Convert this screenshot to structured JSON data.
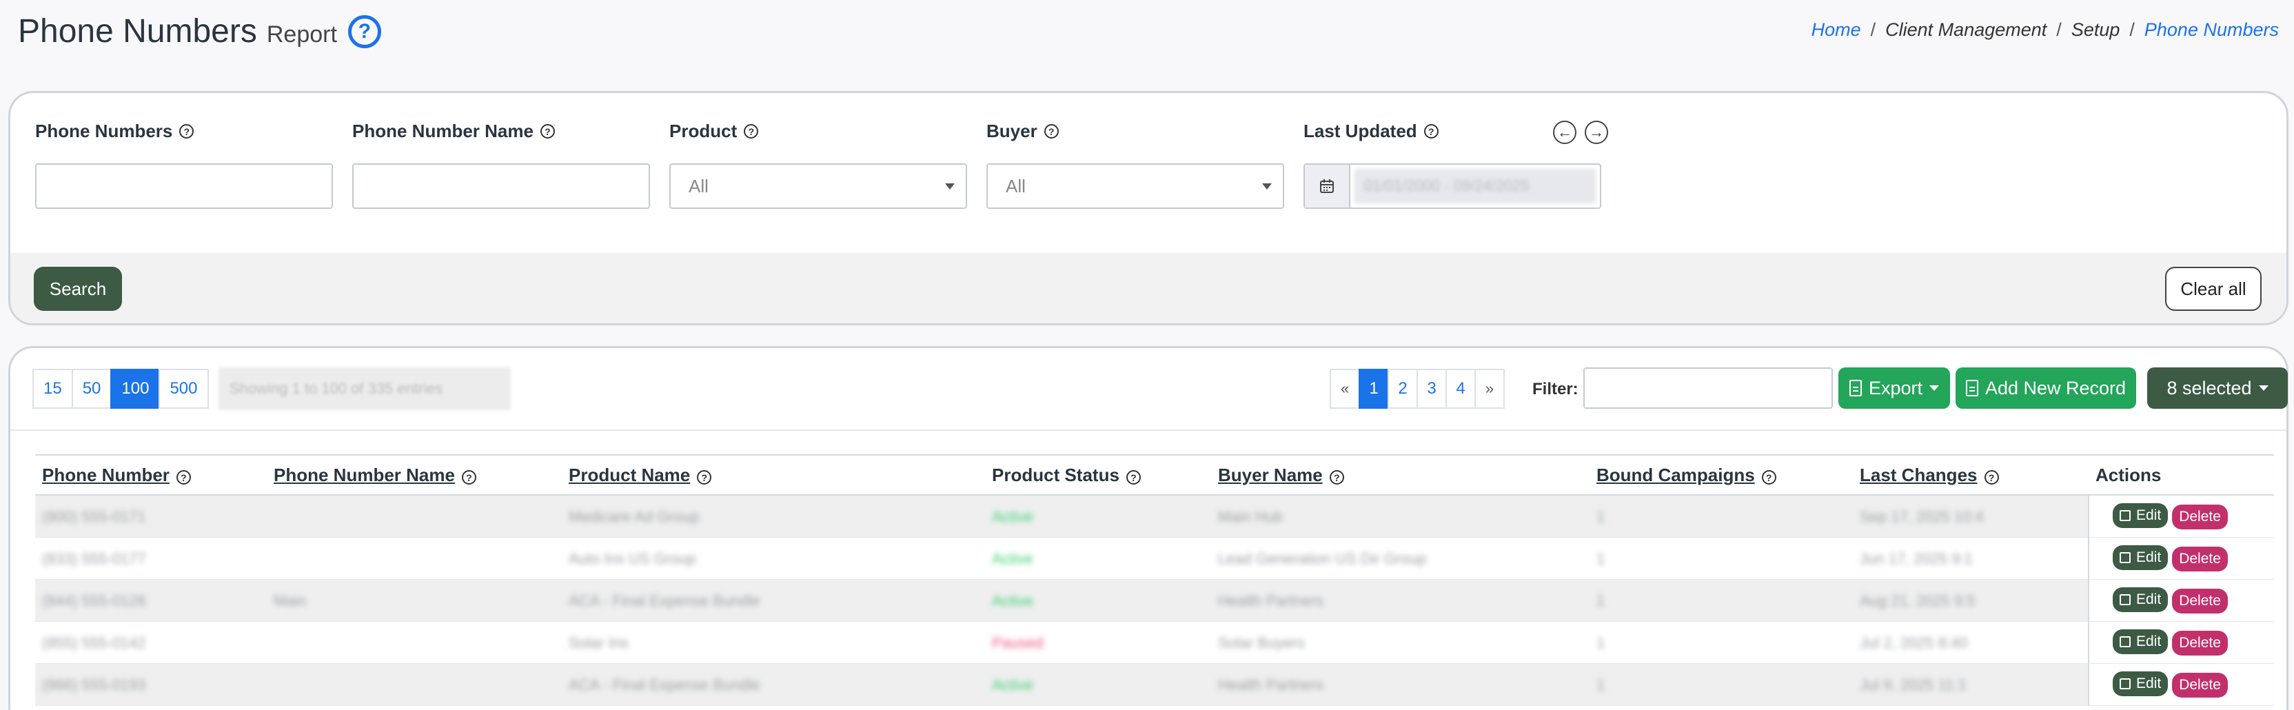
{
  "header": {
    "title": "Phone Numbers",
    "subtitle": "Report",
    "help_icon": "question-circle-icon"
  },
  "breadcrumb": [
    {
      "label": "Home",
      "link": true
    },
    {
      "label": "Client Management",
      "link": false
    },
    {
      "label": "Setup",
      "link": false
    },
    {
      "label": "Phone Numbers",
      "link": true
    }
  ],
  "filters": {
    "phone_numbers": {
      "label": "Phone Numbers",
      "value": ""
    },
    "phone_number_name": {
      "label": "Phone Number Name",
      "value": ""
    },
    "product": {
      "label": "Product",
      "value": "All"
    },
    "buyer": {
      "label": "Buyer",
      "value": "All"
    },
    "last_updated": {
      "label": "Last Updated",
      "value": "01/01/2000 - 09/24/2025"
    },
    "search_label": "Search",
    "clear_label": "Clear all"
  },
  "toolbar": {
    "page_sizes": [
      "15",
      "50",
      "100",
      "500"
    ],
    "active_page_size": "100",
    "entries_info": "Showing 1 to 100 of 335 entries",
    "pages": [
      "«",
      "1",
      "2",
      "3",
      "4",
      "»"
    ],
    "active_page": "1",
    "filter_label": "Filter:",
    "export_label": "Export",
    "add_label": "Add New Record",
    "selected_label": "8 selected"
  },
  "table": {
    "columns": [
      {
        "label": "Phone Number",
        "sortable": true
      },
      {
        "label": "Phone Number Name",
        "sortable": true
      },
      {
        "label": "Product Name",
        "sortable": true
      },
      {
        "label": "Product Status",
        "sortable": false
      },
      {
        "label": "Buyer Name",
        "sortable": true
      },
      {
        "label": "Bound Campaigns",
        "sortable": true
      },
      {
        "label": "Last Changes",
        "sortable": true
      },
      {
        "label": "Actions",
        "sortable": false
      }
    ],
    "edit_label": "Edit",
    "delete_label": "Delete",
    "rows": [
      {
        "phone": "(800) 555-0171",
        "name": "",
        "product": "Medicare Ad Group",
        "status": "Active",
        "status_color": "green",
        "buyer": "Main Hub",
        "campaigns": "1",
        "changed": "Sep 17, 2025 10:4"
      },
      {
        "phone": "(833) 555-0177",
        "name": "",
        "product": "Auto Ins US Group",
        "status": "Active",
        "status_color": "green",
        "buyer": "Lead Generation US Dir Group",
        "campaigns": "1",
        "changed": "Jun 17, 2025 9:1"
      },
      {
        "phone": "(844) 555-0128",
        "name": "Main",
        "product": "ACA - Final Expense Bundle",
        "status": "Active",
        "status_color": "green",
        "buyer": "Health Partners",
        "campaigns": "1",
        "changed": "Aug 21, 2025 9:5"
      },
      {
        "phone": "(855) 555-0142",
        "name": "",
        "product": "Solar Ins",
        "status": "Paused",
        "status_color": "red",
        "buyer": "Solar Buyers",
        "campaigns": "1",
        "changed": "Jul 2, 2025 8:40"
      },
      {
        "phone": "(866) 555-0193",
        "name": "",
        "product": "ACA - Final Expense Bundle",
        "status": "Active",
        "status_color": "green",
        "buyer": "Health Partners",
        "campaigns": "1",
        "changed": "Jul 9, 2025 11:1"
      }
    ]
  },
  "colors": {
    "accent": "#1a73e8",
    "dark_green": "#3c5a44",
    "green": "#23a55a",
    "delete": "#c2306c"
  }
}
